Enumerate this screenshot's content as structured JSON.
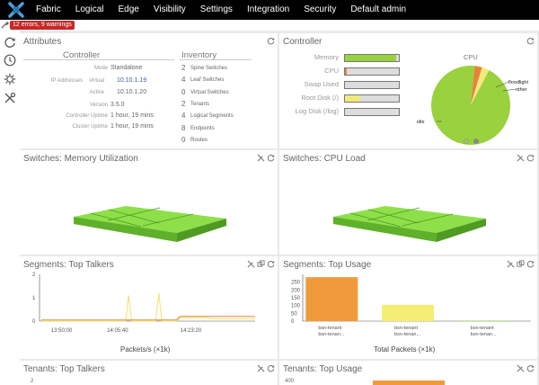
{
  "nav": {
    "items": [
      "Fabric",
      "Logical",
      "Edge",
      "Visibility",
      "Settings",
      "Integration",
      "Security",
      "Default admin"
    ]
  },
  "status": {
    "errors_label": "12 errors, 9 warnings"
  },
  "attributes": {
    "title": "Attributes",
    "controller": {
      "heading": "Controller",
      "rows": [
        {
          "key": "Mode",
          "value": "Standalone"
        },
        {
          "key": "IP Addresses",
          "key2": "Virtual",
          "value": "10.10.1.19"
        },
        {
          "key": "",
          "key2": "Active",
          "value": "10.10.1.20"
        },
        {
          "key": "Version",
          "value": "3.5.0"
        },
        {
          "key": "Controller Uptime",
          "value": "1 hour, 19 mins"
        },
        {
          "key": "Cluster Uptime",
          "value": "1 hour, 19 mins"
        }
      ]
    },
    "inventory": {
      "heading": "Inventory",
      "items": [
        {
          "count": "2",
          "label": "Spine Switches"
        },
        {
          "count": "4",
          "label": "Leaf Switches"
        },
        {
          "count": "0",
          "label": "Virtual Switches"
        },
        {
          "count": "2",
          "label": "Tenants"
        },
        {
          "count": "4",
          "label": "Logical Segments"
        },
        {
          "count": "8",
          "label": "Endpoints"
        },
        {
          "count": "0",
          "label": "Routes"
        }
      ]
    }
  },
  "controller_panel": {
    "title": "Controller",
    "bars": [
      {
        "label": "Memory",
        "fill": 0.95,
        "color": "#9ad13f"
      },
      {
        "label": "CPU",
        "fill": 0.04,
        "color": "#e8833a"
      },
      {
        "label": "Swap Used",
        "fill": 0.0,
        "color": "#9ad13f"
      },
      {
        "label": "Root Disk (/)",
        "fill": 0.28,
        "color": "#f2ea7c"
      },
      {
        "label": "Log Disk (/log)",
        "fill": 0.0,
        "color": "#9ad13f"
      }
    ],
    "cpu_pie": {
      "title": "CPU",
      "slices": [
        {
          "label": "idle",
          "value": 94,
          "color": "#9ad13f"
        },
        {
          "label": "floodlight",
          "value": 3,
          "color": "#e8833a"
        },
        {
          "label": "other",
          "value": 3,
          "color": "#f2ea7c"
        }
      ]
    }
  },
  "mem_panel": {
    "title": "Switches: Memory Utilization",
    "color": "#7ed23a"
  },
  "cpu_panel": {
    "title": "Switches: CPU Load",
    "color": "#7ed23a"
  },
  "talkers_panel": {
    "title": "Segments: Top Talkers",
    "xlabel": "Packets/s (×1k)",
    "chart_data": {
      "type": "line",
      "ylim": [
        0,
        2
      ],
      "yticks": [
        "0",
        "1",
        "2"
      ],
      "xticks": [
        "13:50:00",
        "14:05:40",
        "14:23:20"
      ],
      "series": [
        {
          "color": "#f2e26a",
          "values": [
            0,
            0,
            0,
            0,
            0,
            0,
            0,
            0,
            0,
            0,
            0,
            0,
            0,
            0,
            0,
            0,
            0,
            0,
            0,
            0,
            0,
            0,
            0,
            0,
            0,
            0,
            0,
            0,
            0,
            1.1,
            0,
            0,
            0,
            0,
            0,
            0,
            0,
            0,
            0,
            1.2,
            0,
            0,
            0,
            0,
            0,
            0,
            0.15,
            0.15,
            0.15,
            0.15,
            0.15,
            0.15,
            0.15,
            0.15,
            0.15,
            0.15,
            0.1,
            0.1,
            0.1,
            0.1,
            0.1,
            0.1,
            0.1,
            0.1,
            0.1,
            0.1,
            0.1,
            0.1,
            0.1,
            0.1,
            0.1,
            0.1
          ]
        },
        {
          "color": "#e8833a",
          "values": [
            0.05,
            0.05,
            0.05,
            0.05,
            0.05,
            0.05,
            0.05,
            0.05,
            0.05,
            0.05,
            0.05,
            0.05,
            0.05,
            0.05,
            0.05,
            0.05,
            0.05,
            0.05,
            0.05,
            0.05,
            0.05,
            0.05,
            0.05,
            0.05,
            0.05,
            0.05,
            0.05,
            0.05,
            0.05,
            0.05,
            0.05,
            0.05,
            0.05,
            0.05,
            0.05,
            0.05,
            0.05,
            0.05,
            0.05,
            0.05,
            0.05,
            0.05,
            0.05,
            0.05,
            0.05,
            0.05,
            0.2,
            0.2,
            0.2,
            0.2,
            0.2,
            0.2,
            0.2,
            0.2,
            0.2,
            0.2,
            0.2,
            0.2,
            0.2,
            0.2,
            0.2,
            0.2,
            0.2,
            0.2,
            0.2,
            0.2,
            0.2,
            0.2,
            0.2,
            0.2,
            0.2,
            0.2
          ]
        }
      ]
    }
  },
  "usage_panel": {
    "title": "Segments: Top Usage",
    "xlabel": "Total Packets (×1k)",
    "chart_data": {
      "type": "bar",
      "ylim": [
        0,
        300
      ],
      "yticks": [
        "0",
        "50",
        "100",
        "150",
        "200",
        "250"
      ],
      "categories": [
        {
          "line1": "bsn-tenant",
          "line2": "bsn-tenan..."
        },
        {
          "line1": "bsn-tenant",
          "line2": "bsn-tenan..."
        },
        {
          "line1": "bsn-tenant",
          "line2": "bsn-tenan..."
        }
      ],
      "values": [
        282,
        105,
        2
      ],
      "colors": [
        "#f09a3c",
        "#f4ee74",
        "#9ad13f"
      ]
    }
  },
  "tenant_talkers": {
    "title": "Tenants: Top Talkers",
    "ytick": "2"
  },
  "tenant_usage": {
    "title": "Tenants: Top Usage",
    "ytick": "400"
  }
}
